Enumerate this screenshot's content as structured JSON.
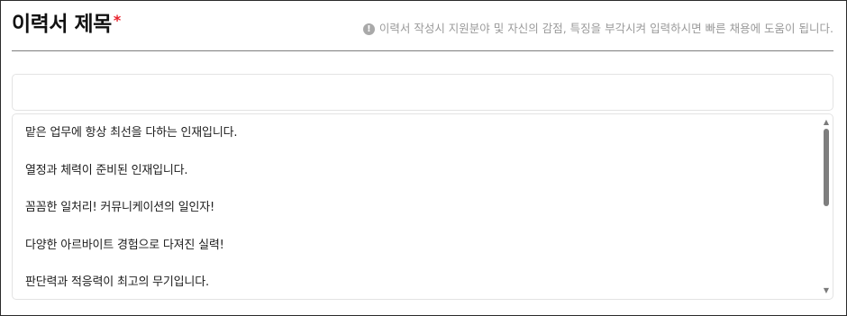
{
  "header": {
    "title": "이력서 제목",
    "required_mark": "*",
    "guide_icon": "info-icon",
    "guide_icon_glyph": "!",
    "guide_text": "이력서 작성시 지원분야 및 자신의 감점, 특징을 부각시켜 입력하시면 빠른 채용에 도움이 됩니다."
  },
  "title_input": {
    "value": "",
    "placeholder": ""
  },
  "suggestions": [
    "맡은 업무에 항상 최선을 다하는 인재입니다.",
    "열정과 체력이 준비된 인재입니다.",
    "꼼꼼한 일처리! 커뮤니케이션의 일인자!",
    "다양한 아르바이트 경험으로 다져진 실력!",
    "판단력과 적응력이 최고의 무기입니다."
  ],
  "scrollbar": {
    "up_glyph": "▲",
    "down_glyph": "▼",
    "position": 0.0
  },
  "colors": {
    "required": "#e8202a",
    "guide_text": "#9a9a9a",
    "divider": "#7d7d7d"
  }
}
